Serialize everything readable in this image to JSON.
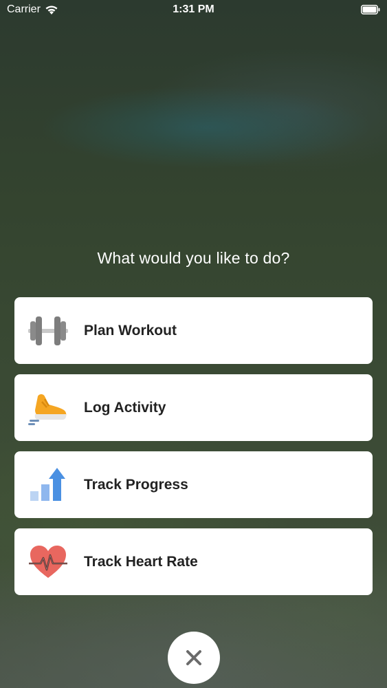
{
  "status_bar": {
    "carrier": "Carrier",
    "time": "1:31 PM",
    "icons": [
      "wifi-icon",
      "battery-icon"
    ]
  },
  "prompt": "What would you like to do?",
  "options": [
    {
      "label": "Plan Workout",
      "icon": "dumbbell-icon"
    },
    {
      "label": "Log Activity",
      "icon": "running-shoe-icon"
    },
    {
      "label": "Track Progress",
      "icon": "progress-chart-icon"
    },
    {
      "label": "Track Heart Rate",
      "icon": "heart-rate-icon"
    }
  ],
  "close_button": {
    "icon": "close-icon"
  },
  "colors": {
    "card_background": "#ffffff",
    "label_text": "#222222",
    "dumbbell": "#8a8a8a",
    "shoe": "#f5a623",
    "progress_arrow": "#4a90e2",
    "progress_bars_light": "#bcd4f3",
    "heart": "#e8675f",
    "close_icon": "#6b6b6b"
  }
}
